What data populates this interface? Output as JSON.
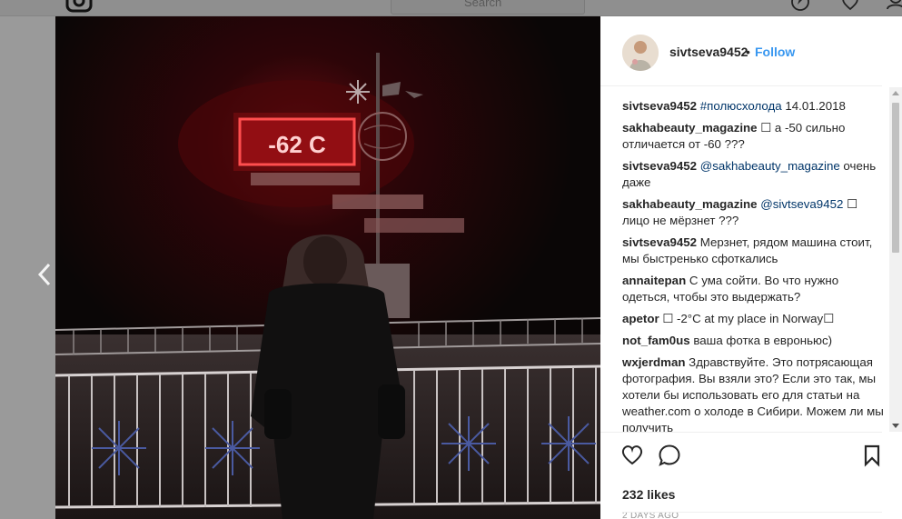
{
  "header": {
    "search_placeholder": "Search"
  },
  "post": {
    "username": "sivtseva9452",
    "separator": "•",
    "follow_label": "Follow",
    "photo": {
      "sign_text": "-62 C"
    }
  },
  "comments": [
    {
      "user": "sivtseva9452",
      "parts": [
        {
          "t": "link",
          "v": "#полюсхолода"
        },
        {
          "t": "text",
          "v": " 14.01.2018"
        }
      ]
    },
    {
      "user": "sakhabeauty_magazine",
      "parts": [
        {
          "t": "text",
          "v": "☐ а -50 сильно отличается от -60 ???"
        }
      ]
    },
    {
      "user": "sivtseva9452",
      "parts": [
        {
          "t": "link",
          "v": "@sakhabeauty_magazine"
        },
        {
          "t": "text",
          "v": " очень даже"
        }
      ]
    },
    {
      "user": "sakhabeauty_magazine",
      "parts": [
        {
          "t": "link",
          "v": "@sivtseva9452"
        },
        {
          "t": "text",
          "v": " ☐ лицо не мёрзнет ???"
        }
      ]
    },
    {
      "user": "sivtseva9452",
      "parts": [
        {
          "t": "text",
          "v": "Мерзнет, рядом машина стоит, мы быстренько сфоткались"
        }
      ]
    },
    {
      "user": "annaitepan",
      "parts": [
        {
          "t": "text",
          "v": "С ума сойти. Во что нужно одеться, чтобы это выдержать?"
        }
      ]
    },
    {
      "user": "apetor",
      "parts": [
        {
          "t": "text",
          "v": "☐ -2°C at my place in Norway☐"
        }
      ]
    },
    {
      "user": "not_fam0us",
      "parts": [
        {
          "t": "text",
          "v": "ваша фотка в евроньюс)"
        }
      ]
    },
    {
      "user": "wxjerdman",
      "parts": [
        {
          "t": "text",
          "v": "Здравствуйте. Это потрясающая фотография. Вы взяли это? Если это так, мы хотели бы использовать его для статьи на weather.com о холоде в Сибири. Можем ли мы получить"
        }
      ]
    }
  ],
  "actions": {
    "likes": "232 likes",
    "time": "2 DAYS AGO"
  }
}
